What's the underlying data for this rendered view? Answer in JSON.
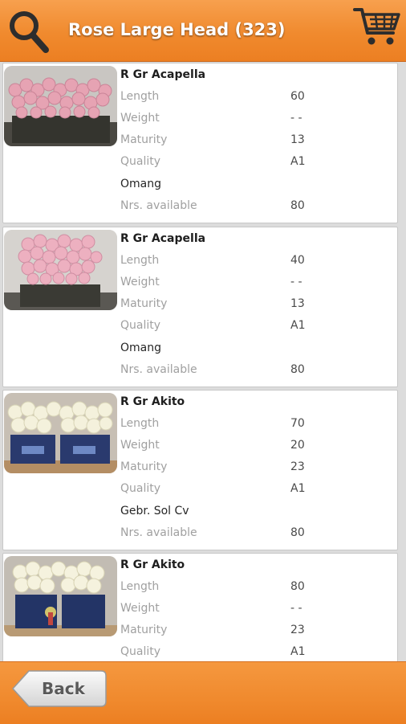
{
  "header": {
    "title": "Rose Large Head (323)",
    "search_icon": "search-icon",
    "cart_icon": "cart-icon"
  },
  "products": [
    {
      "name": "R Gr Acapella",
      "image": "pink-roses",
      "length_label": "Length",
      "length": "60",
      "weight_label": "Weight",
      "weight": "- -",
      "maturity_label": "Maturity",
      "maturity": "13",
      "quality_label": "Quality",
      "quality": "A1",
      "supplier": "Omang",
      "available_label": "Nrs. available",
      "available": "80"
    },
    {
      "name": "R Gr Acapella",
      "image": "pink-roses",
      "length_label": "Length",
      "length": "40",
      "weight_label": "Weight",
      "weight": "- -",
      "maturity_label": "Maturity",
      "maturity": "13",
      "quality_label": "Quality",
      "quality": "A1",
      "supplier": "Omang",
      "available_label": "Nrs. available",
      "available": "80"
    },
    {
      "name": "R Gr Akito",
      "image": "white-roses",
      "length_label": "Length",
      "length": "70",
      "weight_label": "Weight",
      "weight": "20",
      "maturity_label": "Maturity",
      "maturity": "23",
      "quality_label": "Quality",
      "quality": "A1",
      "supplier": "Gebr. Sol Cv",
      "available_label": "Nrs. available",
      "available": "80"
    },
    {
      "name": "R Gr Akito",
      "image": "white-roses",
      "length_label": "Length",
      "length": "80",
      "weight_label": "Weight",
      "weight": "- -",
      "maturity_label": "Maturity",
      "maturity": "23",
      "quality_label": "Quality",
      "quality": "A1"
    }
  ],
  "footer": {
    "back_label": "Back"
  },
  "colors": {
    "accent": "#f08a2e",
    "label": "#a0a0a0",
    "value": "#4a4a4a",
    "card_bg": "#ffffff"
  }
}
